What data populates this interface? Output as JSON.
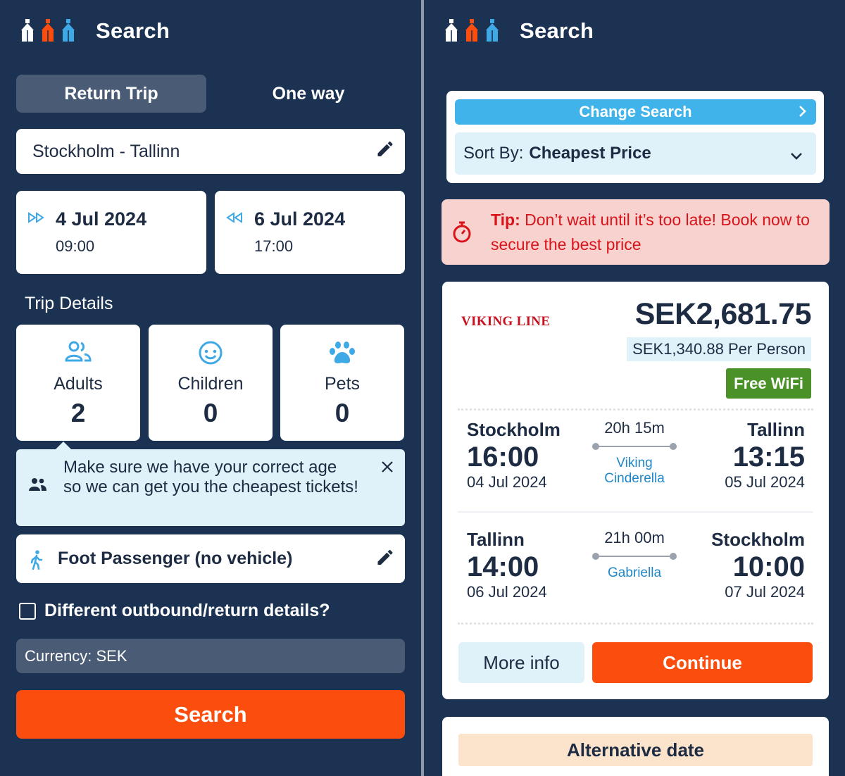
{
  "left": {
    "header": {
      "title": "Search",
      "logo_icon": "ships-logo-icon"
    },
    "trip_toggle": {
      "return_label": "Return Trip",
      "oneway_label": "One way"
    },
    "route": {
      "value": "Stockholm - Tallinn",
      "icon": "pencil-edit-icon"
    },
    "outbound": {
      "date": "4 Jul 2024",
      "time": "09:00",
      "icon": "forward-arrows-icon"
    },
    "return": {
      "date": "6 Jul 2024",
      "time": "17:00",
      "icon": "back-arrows-icon"
    },
    "trip_details_label": "Trip Details",
    "passengers": [
      {
        "label": "Adults",
        "count": "2",
        "icon": "adults-icon"
      },
      {
        "label": "Children",
        "count": "0",
        "icon": "child-face-icon"
      },
      {
        "label": "Pets",
        "count": "0",
        "icon": "paw-icon"
      }
    ],
    "age_notice": {
      "text": "Make sure we have your correct age so we can get you the cheapest tickets!",
      "icon": "people-icon"
    },
    "vehicle": {
      "label": "Foot Passenger (no vehicle)",
      "icon": "walking-person-icon"
    },
    "different_details": {
      "label": "Different outbound/return details?",
      "checked": false
    },
    "currency": {
      "label": "Currency: SEK"
    },
    "search_button": "Search"
  },
  "right": {
    "header": {
      "title": "Search"
    },
    "change_search": "Change Search",
    "sort": {
      "prefix": "Sort By:",
      "value": "Cheapest Price"
    },
    "tip": {
      "bold": "Tip:",
      "text": "Don’t wait until it’s too late! Book now to secure the best price",
      "icon": "stopwatch-icon"
    },
    "result": {
      "operator": "VIKING LINE",
      "total_price": "SEK2,681.75",
      "per_person": "SEK1,340.88 Per Person",
      "badge": "Free WiFi",
      "outbound": {
        "from_city": "Stockholm",
        "from_time": "16:00",
        "from_date": "04 Jul 2024",
        "duration": "20h 15m",
        "ship": "Viking Cinderella",
        "to_city": "Tallinn",
        "to_time": "13:15",
        "to_date": "05 Jul 2024"
      },
      "return": {
        "from_city": "Tallinn",
        "from_time": "14:00",
        "from_date": "06 Jul 2024",
        "duration": "21h 00m",
        "ship": "Gabriella",
        "to_city": "Stockholm",
        "to_time": "10:00",
        "to_date": "07 Jul 2024"
      },
      "more_info": "More info",
      "continue": "Continue"
    },
    "alternative_date": "Alternative date"
  },
  "colors": {
    "background": "#1c3252",
    "accent_orange": "#fb4d0d",
    "accent_blue": "#3fb3ea",
    "icon_blue": "#3fa9e6",
    "wifi_green": "#4a9228",
    "tip_red": "#d8141a"
  }
}
